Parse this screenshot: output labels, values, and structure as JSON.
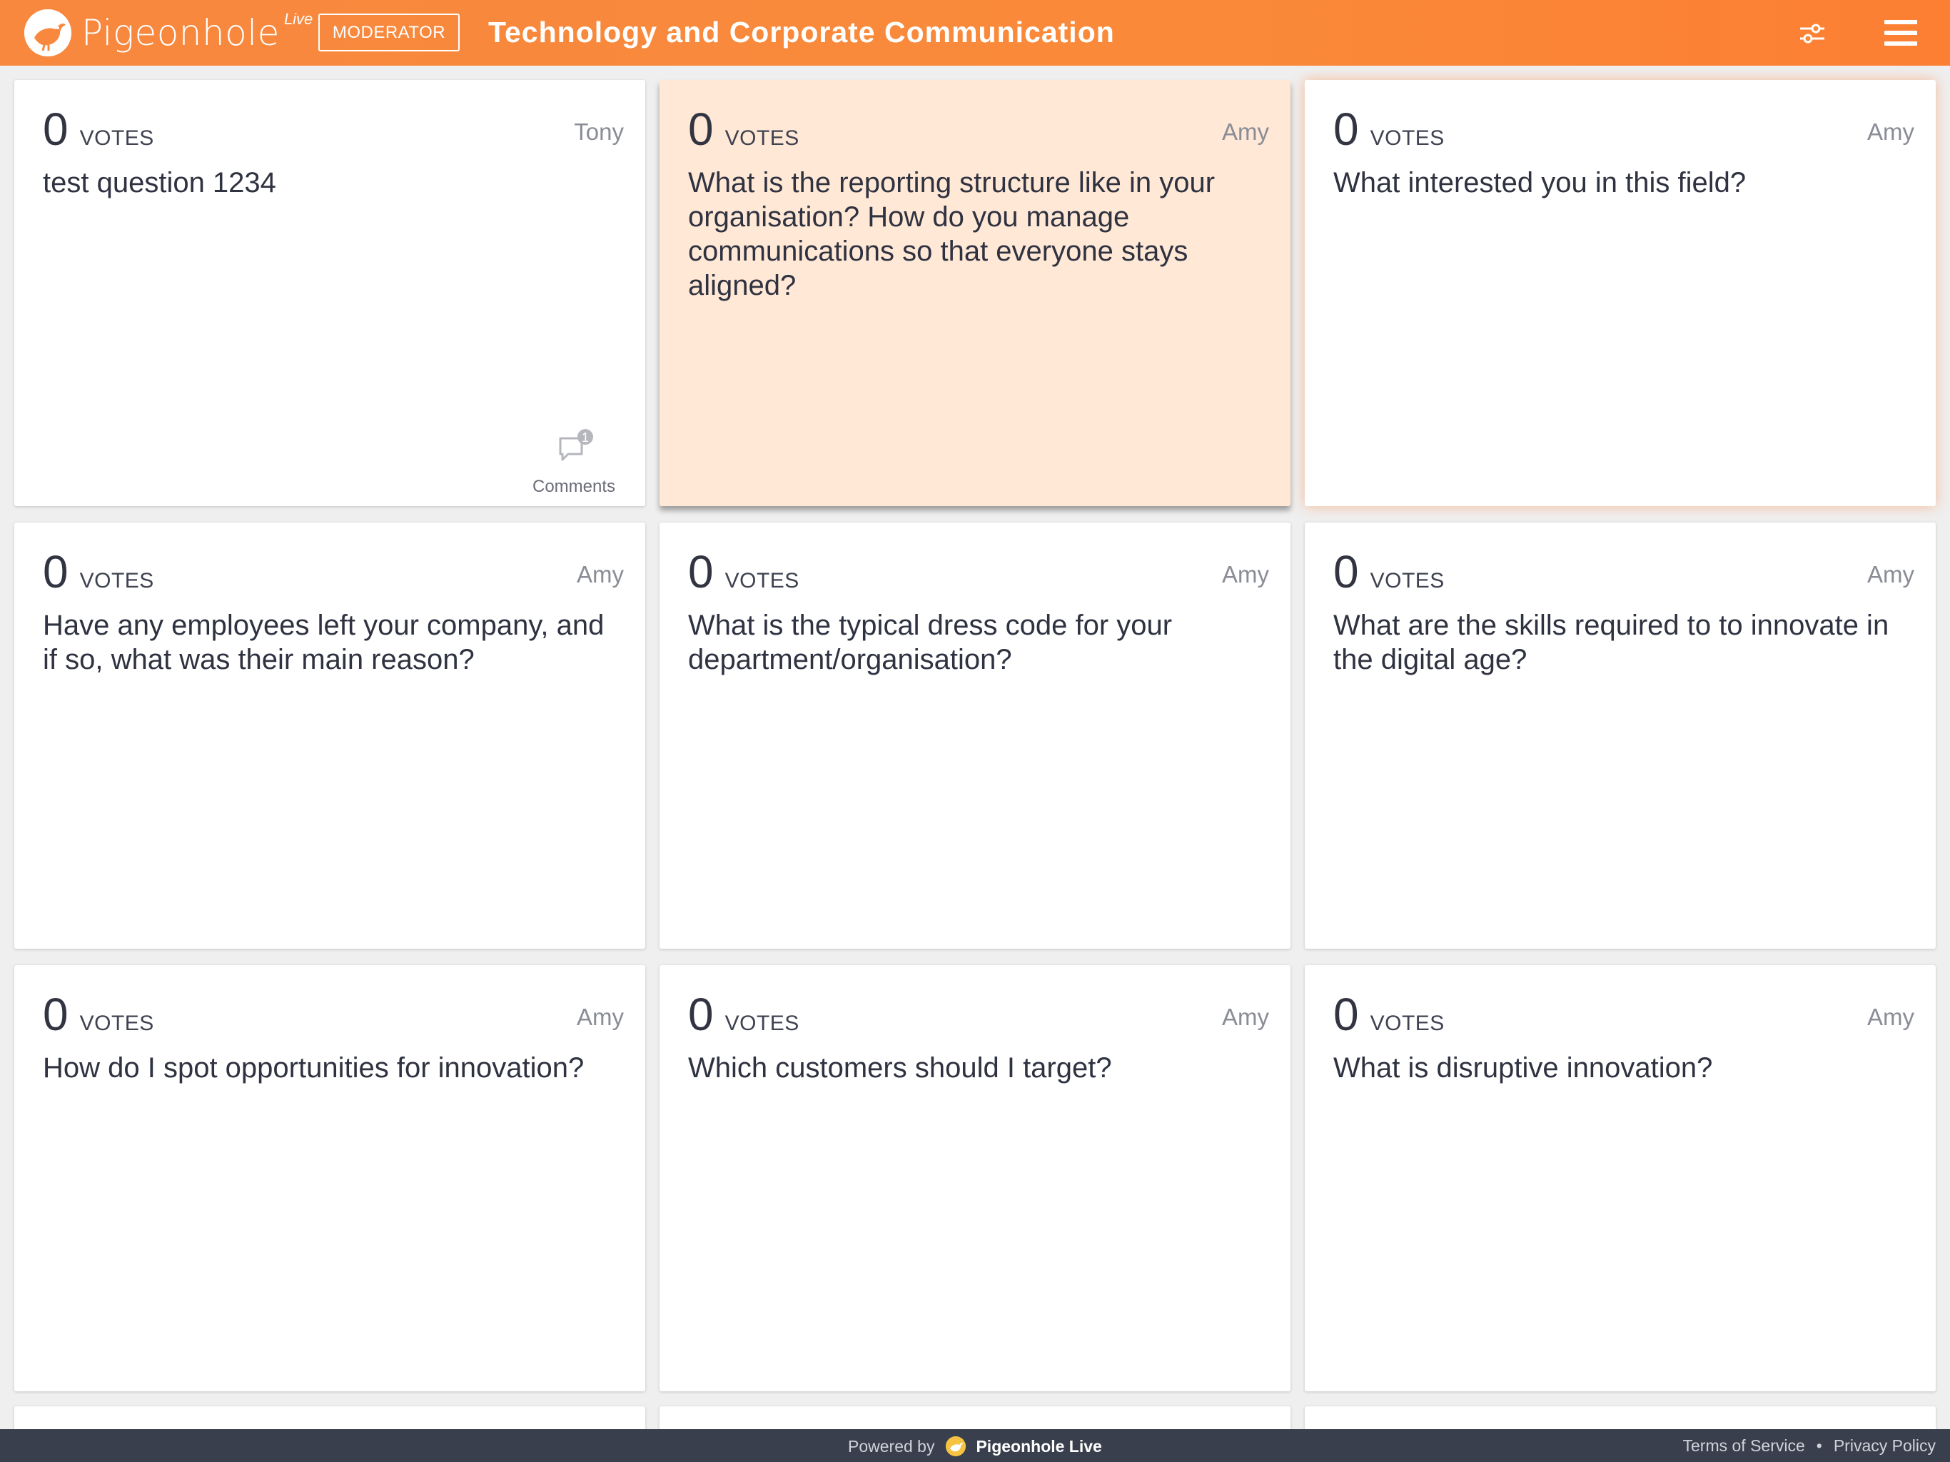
{
  "header": {
    "logo_text": "Pigeonhole",
    "logo_live": "Live",
    "role_badge": "MODERATOR",
    "event_title": "Technology and Corporate Communication",
    "filter_icon": "sliders-icon",
    "menu_icon": "hamburger-menu-icon"
  },
  "colors": {
    "header_accent": "#fa8a3a",
    "highlight_card": "#ffe8d6",
    "footer_bg": "#3a3f4d"
  },
  "questions": [
    {
      "votes": "0",
      "votes_label": "VOTES",
      "author": "Tony",
      "text": "test question 1234",
      "comments_count": "1",
      "comments_label": "Comments"
    },
    {
      "votes": "0",
      "votes_label": "VOTES",
      "author": "Amy",
      "text": "What is the reporting structure like in your organisation? How do you manage communications so that everyone stays aligned?"
    },
    {
      "votes": "0",
      "votes_label": "VOTES",
      "author": "Amy",
      "text": "What interested you in this field?"
    },
    {
      "votes": "0",
      "votes_label": "VOTES",
      "author": "Amy",
      "text": "Have any employees left your company, and if so, what was their main reason?"
    },
    {
      "votes": "0",
      "votes_label": "VOTES",
      "author": "Amy",
      "text": "What is the typical dress code for your department/organisation?"
    },
    {
      "votes": "0",
      "votes_label": "VOTES",
      "author": "Amy",
      "text": "What are the skills required to to innovate in the digital age?"
    },
    {
      "votes": "0",
      "votes_label": "VOTES",
      "author": "Amy",
      "text": "How do I spot opportunities for innovation?"
    },
    {
      "votes": "0",
      "votes_label": "VOTES",
      "author": "Amy",
      "text": "Which customers should I target?"
    },
    {
      "votes": "0",
      "votes_label": "VOTES",
      "author": "Amy",
      "text": "What is disruptive innovation?"
    }
  ],
  "footer": {
    "powered_label": "Powered by",
    "powered_brand": "Pigeonhole Live",
    "terms": "Terms of Service",
    "separator": "•",
    "privacy": "Privacy Policy"
  }
}
